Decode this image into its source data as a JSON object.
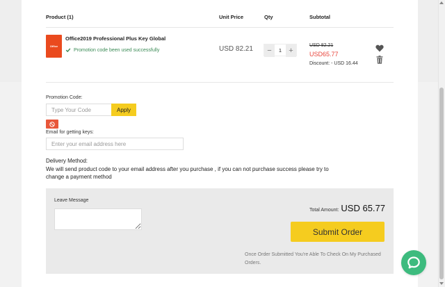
{
  "cart": {
    "headers": {
      "product": "Product (1)",
      "unit_price": "Unit Price",
      "qty": "Qty",
      "subtotal": "Subtotal"
    },
    "item": {
      "thumb_text": "Office",
      "name": "Office2019 Professional Plus Key Global",
      "promo_status": "Promotion code been used successfully",
      "unit_price": "USD 82.21",
      "qty_minus": "−",
      "qty": "1",
      "qty_plus": "+",
      "original_subtotal": "USD 82.21",
      "subtotal": "USD65.77",
      "discount": "Discount: - USD 16.44"
    }
  },
  "promo": {
    "label": "Promotion Code:",
    "placeholder": "Type Your Code",
    "apply_label": "Apply"
  },
  "email": {
    "label": "Email for getting keys:",
    "placeholder": "Enter your email address here"
  },
  "delivery": {
    "title": "Delivery Method:",
    "text": "We will send product code to your email address after you purchase , if you can not purchase success please try to change a payment method"
  },
  "order": {
    "leave_message_label": "Leave Message",
    "total_label": "Total Amount:",
    "total_value": "USD 65.77",
    "submit_label": "Submit Order",
    "note": "Once Order Submitted You're Able To Check On My Purchased Orders."
  },
  "colors": {
    "accent_yellow": "#f5cc1f",
    "price_red": "#e8453c",
    "success_green": "#3a8a55",
    "chat_green": "#3dbb7e",
    "clear_button": "#e8573a"
  },
  "icons": {
    "heart": "heart-icon",
    "trash": "trash-icon",
    "check": "check-icon",
    "clear": "no-entry-icon",
    "chat": "chat-bubble-icon"
  }
}
